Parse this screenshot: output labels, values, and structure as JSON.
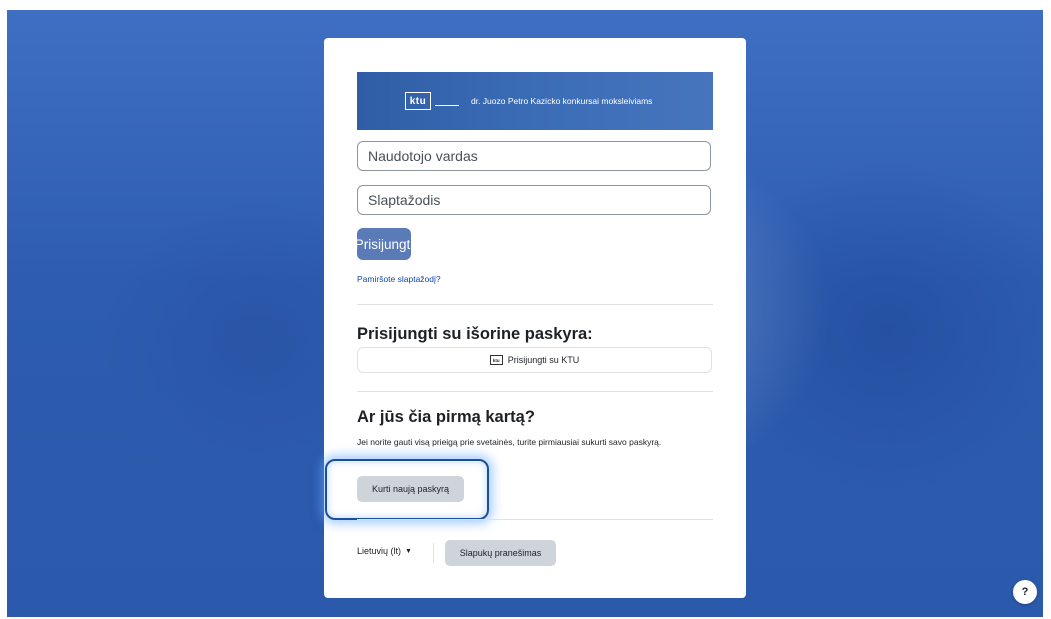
{
  "banner": {
    "logo_text": "ktu",
    "text": "dr. Juozo Petro Kazicko konkursai moksleiviams"
  },
  "login": {
    "username_placeholder": "Naudotojo vardas",
    "password_placeholder": "Slaptažodis",
    "submit_label": "Prisijungti",
    "forgot_link": "Pamiršote slaptažodį?"
  },
  "external": {
    "heading": "Prisijungti su išorine paskyra:",
    "ktu_icon_text": "ktu",
    "ktu_button": "Prisijungti su KTU"
  },
  "signup": {
    "heading": "Ar jūs čia pirmą kartą?",
    "text": "Jei norite gauti visą prieigą prie svetainės, turite pirmiausiai sukurti savo paskyrą.",
    "button": "Kurti naują paskyrą"
  },
  "footer": {
    "language": "Lietuvių (lt)",
    "cookies_button": "Slapukų pranešimas"
  },
  "help": {
    "label": "?"
  },
  "colors": {
    "primary": "#5a7ab8",
    "background": "#2d5cb0",
    "highlight": "#1d4e9c"
  }
}
